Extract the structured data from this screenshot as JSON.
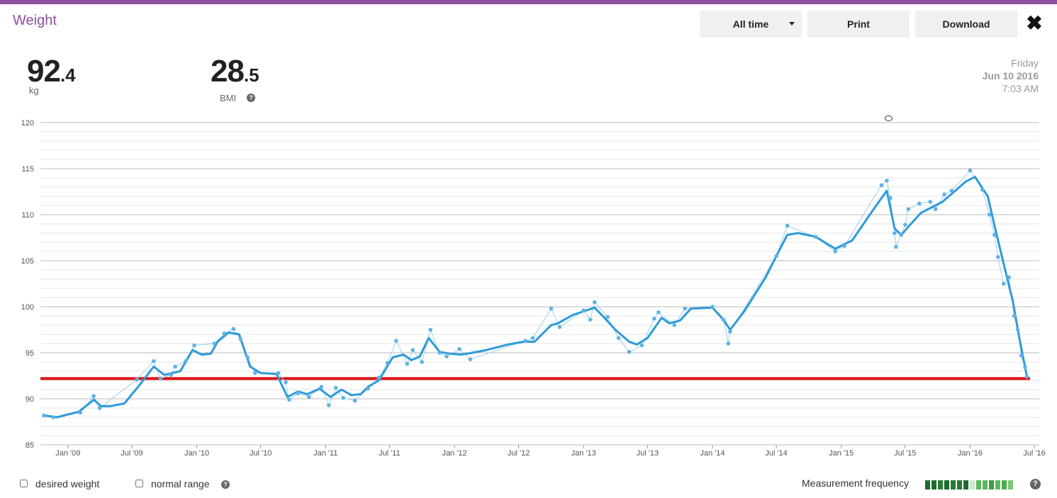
{
  "header": {
    "title": "Weight",
    "range_select": "All time",
    "print_label": "Print",
    "download_label": "Download",
    "close_icon": "close-icon",
    "accent_color": "#8e4f9e"
  },
  "summary": {
    "weight_int": "92",
    "weight_dec": ".4",
    "weight_unit": "kg",
    "bmi_int": "28",
    "bmi_dec": ".5",
    "bmi_label": "BMI",
    "help_icon": "?"
  },
  "date": {
    "weekday": "Friday",
    "date": "Jun 10 2016",
    "time": "7:03 AM"
  },
  "chart_data": {
    "type": "line",
    "title": "",
    "xlabel": "",
    "ylabel": "",
    "ylim": [
      85,
      120
    ],
    "xlim": [
      "2008-10-15",
      "2016-07-15"
    ],
    "y_ticks": [
      85,
      90,
      95,
      100,
      105,
      110,
      115,
      120
    ],
    "x_tick_labels": [
      {
        "label": "Jan '09",
        "date": "2009-01-01"
      },
      {
        "label": "Jul '09",
        "date": "2009-07-01"
      },
      {
        "label": "Jan '10",
        "date": "2010-01-01"
      },
      {
        "label": "Jul '10",
        "date": "2010-07-01"
      },
      {
        "label": "Jan '11",
        "date": "2011-01-01"
      },
      {
        "label": "Jul '11",
        "date": "2011-07-01"
      },
      {
        "label": "Jan '12",
        "date": "2012-01-01"
      },
      {
        "label": "Jul '12",
        "date": "2012-07-01"
      },
      {
        "label": "Jan '13",
        "date": "2013-01-01"
      },
      {
        "label": "Jul '13",
        "date": "2013-07-01"
      },
      {
        "label": "Jan '14",
        "date": "2014-01-01"
      },
      {
        "label": "Jul '14",
        "date": "2014-07-01"
      },
      {
        "label": "Jan '15",
        "date": "2015-01-01"
      },
      {
        "label": "Jul '15",
        "date": "2015-07-01"
      },
      {
        "label": "Jan '16",
        "date": "2016-01-01"
      },
      {
        "label": "Jul '16",
        "date": "2016-07-01"
      }
    ],
    "reference_line": {
      "value": 92.2,
      "color": "#dd1111"
    },
    "line_color": "#2e9ad8",
    "point_color": "#5fb3e6",
    "grid": true,
    "comment_marker_date": "2015-05-15",
    "series": [
      {
        "type": "trend",
        "points": [
          [
            "2008-10-25",
            88.2
          ],
          [
            "2008-12-01",
            88.0
          ],
          [
            "2009-02-01",
            88.6
          ],
          [
            "2009-03-15",
            89.9
          ],
          [
            "2009-04-05",
            89.2
          ],
          [
            "2009-05-01",
            89.2
          ],
          [
            "2009-06-10",
            89.5
          ],
          [
            "2009-07-25",
            91.6
          ],
          [
            "2009-09-01",
            93.5
          ],
          [
            "2009-10-01",
            92.6
          ],
          [
            "2009-11-15",
            93.0
          ],
          [
            "2009-12-20",
            95.3
          ],
          [
            "2010-01-15",
            94.8
          ],
          [
            "2010-02-10",
            94.9
          ],
          [
            "2010-03-01",
            96.2
          ],
          [
            "2010-04-01",
            97.2
          ],
          [
            "2010-05-01",
            97.0
          ],
          [
            "2010-06-01",
            93.5
          ],
          [
            "2010-07-01",
            92.8
          ],
          [
            "2010-08-15",
            92.7
          ],
          [
            "2010-09-15",
            90.2
          ],
          [
            "2010-10-15",
            90.8
          ],
          [
            "2010-11-10",
            90.5
          ],
          [
            "2010-12-15",
            91.1
          ],
          [
            "2011-01-15",
            90.2
          ],
          [
            "2011-02-15",
            91.0
          ],
          [
            "2011-03-15",
            90.4
          ],
          [
            "2011-04-10",
            90.5
          ],
          [
            "2011-05-01",
            91.3
          ],
          [
            "2011-06-01",
            92.0
          ],
          [
            "2011-07-10",
            94.5
          ],
          [
            "2011-08-10",
            94.8
          ],
          [
            "2011-09-01",
            94.2
          ],
          [
            "2011-09-25",
            94.6
          ],
          [
            "2011-10-20",
            96.6
          ],
          [
            "2011-11-20",
            95.1
          ],
          [
            "2011-12-20",
            94.9
          ],
          [
            "2012-01-20",
            94.8
          ],
          [
            "2012-02-20",
            95.0
          ],
          [
            "2012-04-01",
            95.3
          ],
          [
            "2012-06-01",
            95.9
          ],
          [
            "2012-07-15",
            96.2
          ],
          [
            "2012-08-15",
            96.2
          ],
          [
            "2012-10-01",
            98.0
          ],
          [
            "2012-10-20",
            98.2
          ],
          [
            "2012-12-01",
            99.1
          ],
          [
            "2013-01-01",
            99.5
          ],
          [
            "2013-02-01",
            99.9
          ],
          [
            "2013-03-01",
            98.8
          ],
          [
            "2013-04-01",
            97.5
          ],
          [
            "2013-05-10",
            96.2
          ],
          [
            "2013-06-01",
            95.9
          ],
          [
            "2013-07-01",
            96.6
          ],
          [
            "2013-08-10",
            98.8
          ],
          [
            "2013-09-01",
            98.2
          ],
          [
            "2013-10-01",
            98.5
          ],
          [
            "2013-11-01",
            99.8
          ],
          [
            "2014-01-01",
            99.9
          ],
          [
            "2014-02-01",
            98.6
          ],
          [
            "2014-02-20",
            97.5
          ],
          [
            "2014-04-01",
            99.5
          ],
          [
            "2014-06-01",
            103.2
          ],
          [
            "2014-07-01",
            105.5
          ],
          [
            "2014-08-01",
            107.8
          ],
          [
            "2014-09-01",
            108.0
          ],
          [
            "2014-10-20",
            107.6
          ],
          [
            "2014-12-15",
            106.3
          ],
          [
            "2015-02-01",
            107.2
          ],
          [
            "2015-04-01",
            110.5
          ],
          [
            "2015-05-10",
            112.6
          ],
          [
            "2015-06-01",
            108.5
          ],
          [
            "2015-06-20",
            107.8
          ],
          [
            "2015-07-15",
            108.9
          ],
          [
            "2015-08-15",
            110.2
          ],
          [
            "2015-09-15",
            110.8
          ],
          [
            "2015-10-15",
            111.4
          ],
          [
            "2015-11-20",
            112.6
          ],
          [
            "2015-12-20",
            113.6
          ],
          [
            "2016-01-15",
            114.1
          ],
          [
            "2016-02-20",
            112.0
          ],
          [
            "2016-03-15",
            108.0
          ],
          [
            "2016-04-10",
            103.9
          ],
          [
            "2016-05-01",
            100.6
          ],
          [
            "2016-05-20",
            96.5
          ],
          [
            "2016-06-10",
            92.4
          ]
        ]
      },
      {
        "type": "measurements",
        "points": [
          [
            "2008-10-25",
            88.2
          ],
          [
            "2008-11-20",
            88.0
          ],
          [
            "2009-02-05",
            88.5
          ],
          [
            "2009-03-15",
            90.3
          ],
          [
            "2009-04-01",
            89.0
          ],
          [
            "2009-07-15",
            92.1
          ],
          [
            "2009-09-01",
            94.1
          ],
          [
            "2009-09-20",
            92.2
          ],
          [
            "2009-10-20",
            92.6
          ],
          [
            "2009-11-01",
            93.5
          ],
          [
            "2009-12-01",
            94.1
          ],
          [
            "2009-12-25",
            95.8
          ],
          [
            "2010-02-20",
            96.0
          ],
          [
            "2010-03-20",
            97.1
          ],
          [
            "2010-04-15",
            97.6
          ],
          [
            "2010-05-05",
            96.5
          ],
          [
            "2010-05-25",
            94.5
          ],
          [
            "2010-06-15",
            92.8
          ],
          [
            "2010-08-20",
            92.8
          ],
          [
            "2010-09-10",
            91.8
          ],
          [
            "2010-09-20",
            89.9
          ],
          [
            "2010-10-15",
            90.6
          ],
          [
            "2010-11-15",
            90.2
          ],
          [
            "2010-12-20",
            91.3
          ],
          [
            "2011-01-10",
            89.3
          ],
          [
            "2011-01-30",
            91.2
          ],
          [
            "2011-02-20",
            90.1
          ],
          [
            "2011-03-25",
            89.8
          ],
          [
            "2011-05-01",
            91.1
          ],
          [
            "2011-06-01",
            92.3
          ],
          [
            "2011-06-25",
            93.9
          ],
          [
            "2011-07-20",
            96.3
          ],
          [
            "2011-08-20",
            93.8
          ],
          [
            "2011-09-05",
            95.3
          ],
          [
            "2011-10-01",
            94.0
          ],
          [
            "2011-10-25",
            97.5
          ],
          [
            "2011-11-20",
            95.0
          ],
          [
            "2011-12-10",
            94.6
          ],
          [
            "2012-01-15",
            95.4
          ],
          [
            "2012-02-15",
            94.3
          ],
          [
            "2012-07-20",
            96.3
          ],
          [
            "2012-08-10",
            96.6
          ],
          [
            "2012-10-01",
            99.8
          ],
          [
            "2012-10-25",
            97.8
          ],
          [
            "2013-01-01",
            99.6
          ],
          [
            "2013-01-20",
            98.6
          ],
          [
            "2013-02-01",
            100.5
          ],
          [
            "2013-03-10",
            98.9
          ],
          [
            "2013-04-10",
            96.6
          ],
          [
            "2013-05-10",
            95.1
          ],
          [
            "2013-06-15",
            95.8
          ],
          [
            "2013-07-20",
            98.7
          ],
          [
            "2013-08-01",
            99.4
          ],
          [
            "2013-09-15",
            98.0
          ],
          [
            "2013-10-15",
            99.8
          ],
          [
            "2014-01-01",
            100.0
          ],
          [
            "2014-02-01",
            98.6
          ],
          [
            "2014-02-15",
            96.0
          ],
          [
            "2014-02-20",
            97.3
          ],
          [
            "2014-07-01",
            105.5
          ],
          [
            "2014-08-01",
            108.8
          ],
          [
            "2014-10-20",
            107.6
          ],
          [
            "2014-12-15",
            106.0
          ],
          [
            "2015-01-10",
            106.6
          ],
          [
            "2015-04-25",
            113.2
          ],
          [
            "2015-05-10",
            113.7
          ],
          [
            "2015-05-20",
            111.8
          ],
          [
            "2015-06-01",
            108.0
          ],
          [
            "2015-06-05",
            106.5
          ],
          [
            "2015-06-20",
            107.8
          ],
          [
            "2015-07-01",
            108.9
          ],
          [
            "2015-07-10",
            110.6
          ],
          [
            "2015-08-10",
            111.2
          ],
          [
            "2015-09-10",
            111.4
          ],
          [
            "2015-09-25",
            110.6
          ],
          [
            "2015-10-20",
            112.2
          ],
          [
            "2015-11-10",
            112.6
          ],
          [
            "2016-01-01",
            114.8
          ],
          [
            "2016-02-05",
            112.7
          ],
          [
            "2016-02-25",
            110.0
          ],
          [
            "2016-03-10",
            107.8
          ],
          [
            "2016-03-20",
            105.4
          ],
          [
            "2016-04-05",
            102.5
          ],
          [
            "2016-04-20",
            103.2
          ],
          [
            "2016-05-05",
            99.0
          ],
          [
            "2016-05-15",
            97.5
          ],
          [
            "2016-05-25",
            94.7
          ],
          [
            "2016-06-05",
            93.4
          ],
          [
            "2016-06-10",
            92.4
          ]
        ]
      }
    ]
  },
  "footer": {
    "desired_weight_label": "desired weight",
    "normal_range_label": "normal range",
    "frequency_label": "Measurement frequency",
    "frequency_colors": [
      "#1e6b2e",
      "#1e6b2e",
      "#2a7a35",
      "#1e6b2e",
      "#2a7a35",
      "#2a7a35",
      "#1e6b2e",
      "#cfe8cf",
      "#5cb85c",
      "#5cb85c",
      "#3d9a47",
      "#5cb85c",
      "#4cae4c",
      "#7cc67c"
    ]
  }
}
